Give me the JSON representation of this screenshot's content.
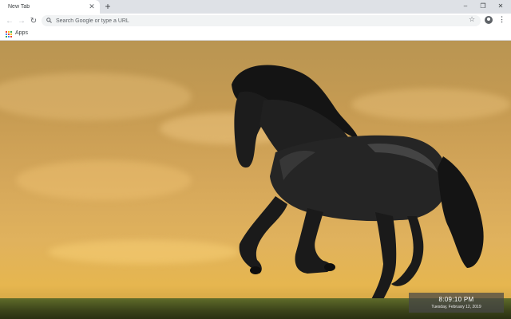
{
  "browser": {
    "tab": {
      "title": "New Tab",
      "close_glyph": "✕"
    },
    "new_tab_glyph": "+",
    "window_controls": {
      "minimize": "–",
      "restore": "❐",
      "close": "✕"
    }
  },
  "toolbar": {
    "back_icon": "←",
    "forward_icon": "→",
    "reload_icon": "↻",
    "omnibox": {
      "placeholder": "Search Google or type a URL",
      "value": ""
    },
    "bookmark_star_icon": "☆",
    "menu_icon": "⋮"
  },
  "bookmarks_bar": {
    "apps_label": "Apps",
    "apps_icon_colors": [
      "#ea4335",
      "#fbbc04",
      "#34a853",
      "#4285f4",
      "#ea4335",
      "#fbbc04",
      "#34a853",
      "#4285f4",
      "#ea4335"
    ]
  },
  "new_tab_page": {
    "background_theme": "black horse galloping at sunset",
    "clock": {
      "time": "8:09:10 PM",
      "date": "Tuesday, February 12, 2019"
    }
  }
}
